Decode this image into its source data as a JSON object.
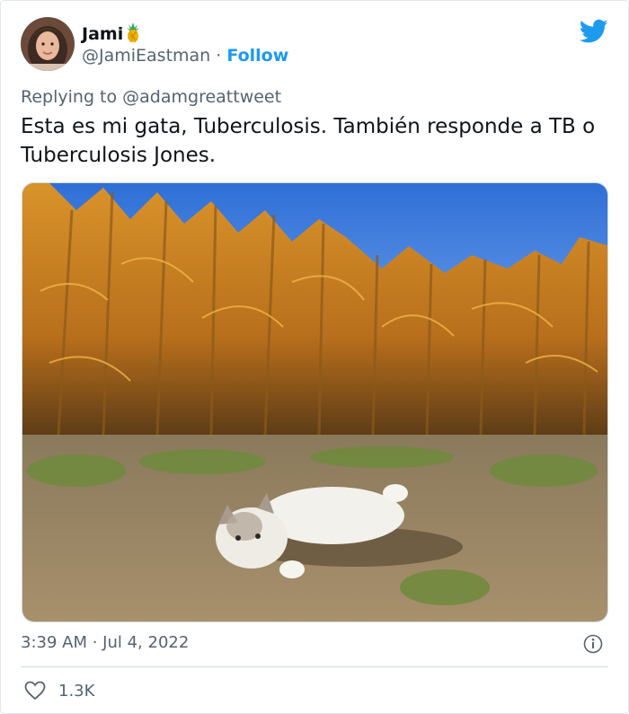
{
  "author": {
    "display_name": "Jami",
    "name_emoji": "pineapple-emoji",
    "handle": "@JamiEastman",
    "separator": "·",
    "follow_label": "Follow"
  },
  "reply": {
    "label": "Replying to @adamgreattweet"
  },
  "tweet": {
    "text": "Esta es mi gata, Tuberculosis. También responde a TB o Tuberculosis Jones."
  },
  "media": {
    "description": "photo"
  },
  "meta": {
    "timestamp": "3:39 AM · Jul 4, 2022"
  },
  "engagement": {
    "likes": "1.3K"
  },
  "icons": {
    "brand": "twitter-bird-icon",
    "info": "info-icon",
    "like": "heart-icon"
  },
  "colors": {
    "accent": "#1d9bf0",
    "text": "#0f1419",
    "secondary": "#536471"
  }
}
